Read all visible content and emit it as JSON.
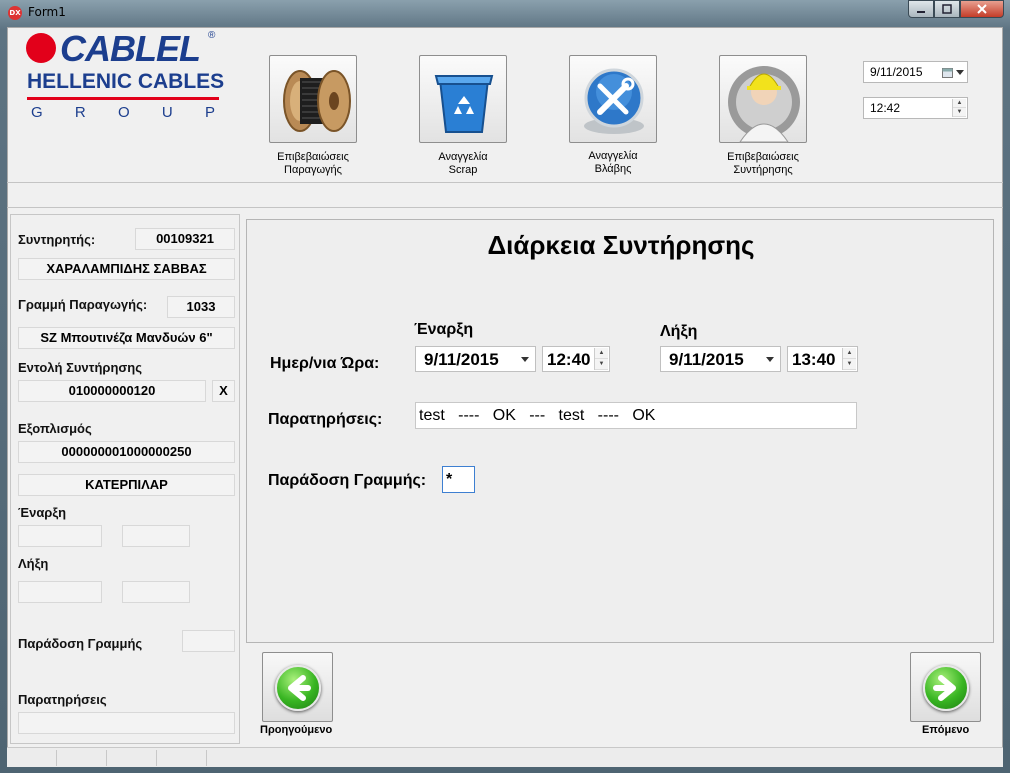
{
  "window": {
    "title": "Form1",
    "icon_text": "DX"
  },
  "logo": {
    "brand": "CABLEL",
    "registered": "®",
    "line2": "HELLENIC CABLES",
    "line3": [
      "G",
      "R",
      "O",
      "U",
      "P"
    ]
  },
  "toolbar": [
    {
      "icon": "cable-reel-icon",
      "label_line1": "Επιβεβαιώσεις",
      "label_line2": "Παραγωγής"
    },
    {
      "icon": "recycle-bin-icon",
      "label_line1": "Αναγγελία",
      "label_line2": "Scrap"
    },
    {
      "icon": "tools-icon",
      "label_line1": "Αναγγελία",
      "label_line2": "Βλάβης"
    },
    {
      "icon": "maintenance-worker-icon",
      "label_line1": "Επιβεβαιώσεις",
      "label_line2": "Συντήρησης"
    }
  ],
  "header_datetime": {
    "date": "9/11/2015",
    "time": "12:42"
  },
  "left_panel": {
    "maintainer_label": "Συντηρητής:",
    "maintainer_code": "00109321",
    "maintainer_name": "ΧΑΡΑΛΑΜΠΙΔΗΣ ΣΑΒΒΑΣ",
    "line_label": "Γραμμή Παραγωγής:",
    "line_code": "1033",
    "line_name": "SZ Μπουτινέζα Μανδυών 6\"",
    "order_label": "Εντολή Συντήρησης",
    "order_value": "010000000120",
    "order_clear": "X",
    "equipment_label": "Εξοπλισμός",
    "equipment_value": "000000001000000250",
    "equipment_name": "ΚΑΤΕΡΠΙΛΑΡ",
    "start_label": "Έναρξη",
    "end_label": "Λήξη",
    "handover_label": "Παράδοση Γραμμής",
    "remarks_label": "Παρατηρήσεις"
  },
  "main": {
    "title": "Διάρκεια Συντήρησης",
    "start_header": "Έναρξη",
    "end_header": "Λήξη",
    "datetime_label": "Ημερ/νια Ώρα:",
    "start_date": "9/11/2015",
    "start_time": "12:40",
    "end_date": "9/11/2015",
    "end_time": "13:40",
    "remarks_label": "Παρατηρήσεις:",
    "remarks_value": "test   ----   OK   ---   test   ----   OK",
    "handover_label": "Παράδοση Γραμμής:",
    "handover_value": "*"
  },
  "nav": {
    "prev_label": "Προηγούμενο",
    "next_label": "Επόμενο"
  },
  "colors": {
    "brand_blue": "#1c3e8e",
    "brand_red": "#e2001a",
    "nav_green": "#38b522"
  }
}
